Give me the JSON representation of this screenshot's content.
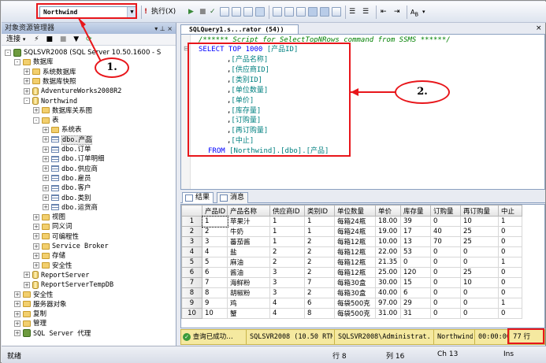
{
  "toolbar": {
    "database": "Northwind",
    "execute": "执行(X)",
    "execute_icon": "exclamation-icon"
  },
  "object_explorer": {
    "title": "对象资源管理器",
    "connect_label": "连接",
    "tree": [
      {
        "label": "SQLSVR2008 (SQL Server 10.50.1600 - S",
        "icon": "server",
        "exp": "-"
      },
      {
        "label": "数据库",
        "icon": "folder",
        "exp": "-"
      },
      {
        "label": "系统数据库",
        "icon": "folder",
        "exp": "+"
      },
      {
        "label": "数据库快照",
        "icon": "folder",
        "exp": "+"
      },
      {
        "label": "AdventureWorks2008R2",
        "icon": "db",
        "exp": "+"
      },
      {
        "label": "Northwind",
        "icon": "db",
        "exp": "-"
      },
      {
        "label": "数据库关系图",
        "icon": "folder",
        "exp": "+"
      },
      {
        "label": "表",
        "icon": "folder",
        "exp": "-"
      },
      {
        "label": "系统表",
        "icon": "folder",
        "exp": "+"
      },
      {
        "label": "dbo.产品",
        "icon": "table",
        "exp": "+"
      },
      {
        "label": "dbo.订单",
        "icon": "table",
        "exp": "+"
      },
      {
        "label": "dbo.订单明细",
        "icon": "table",
        "exp": "+"
      },
      {
        "label": "dbo.供应商",
        "icon": "table",
        "exp": "+"
      },
      {
        "label": "dbo.雇员",
        "icon": "table",
        "exp": "+"
      },
      {
        "label": "dbo.客户",
        "icon": "table",
        "exp": "+"
      },
      {
        "label": "dbo.类别",
        "icon": "table",
        "exp": "+"
      },
      {
        "label": "dbo.运货商",
        "icon": "table",
        "exp": "+"
      },
      {
        "label": "视图",
        "icon": "folder",
        "exp": "+"
      },
      {
        "label": "同义词",
        "icon": "folder",
        "exp": "+"
      },
      {
        "label": "可编程性",
        "icon": "folder",
        "exp": "+"
      },
      {
        "label": "Service Broker",
        "icon": "folder",
        "exp": "+"
      },
      {
        "label": "存储",
        "icon": "folder",
        "exp": "+"
      },
      {
        "label": "安全性",
        "icon": "folder",
        "exp": "+"
      },
      {
        "label": "ReportServer",
        "icon": "db",
        "exp": "+"
      },
      {
        "label": "ReportServerTempDB",
        "icon": "db",
        "exp": "+"
      },
      {
        "label": "安全性",
        "icon": "folder",
        "exp": "+"
      },
      {
        "label": "服务器对象",
        "icon": "folder",
        "exp": "+"
      },
      {
        "label": "复制",
        "icon": "folder",
        "exp": "+"
      },
      {
        "label": "管理",
        "icon": "folder",
        "exp": "+"
      },
      {
        "label": "SQL Server 代理",
        "icon": "agent",
        "exp": "+"
      }
    ]
  },
  "document_tab": "SQLQuery1.s...rator (54))",
  "editor": {
    "comment": "/****** Script for SelectTopNRows command from SSMS  ******/",
    "select": "SELECT TOP 1000",
    "columns": [
      "[产品ID]",
      "[产品名称]",
      "[供应商ID]",
      "[类别ID]",
      "[单位数量]",
      "[单价]",
      "[库存量]",
      "[订购量]",
      "[再订购量]",
      "[中止]"
    ],
    "from_kw": "FROM",
    "from_table": "[Northwind].[dbo].[产品]"
  },
  "results": {
    "tab_results": "结果",
    "tab_messages": "消息",
    "headers": [
      "产品ID",
      "产品名称",
      "供应商ID",
      "类别ID",
      "单位数量",
      "单价",
      "库存量",
      "订购量",
      "再订购量",
      "中止"
    ],
    "rows": [
      [
        "1",
        "1",
        "苹果汁",
        "1",
        "1",
        "每箱24瓶",
        "18.00",
        "39",
        "0",
        "10",
        "1"
      ],
      [
        "2",
        "2",
        "牛奶",
        "1",
        "1",
        "每箱24瓶",
        "19.00",
        "17",
        "40",
        "25",
        "0"
      ],
      [
        "3",
        "3",
        "蕃茄酱",
        "1",
        "2",
        "每箱12瓶",
        "10.00",
        "13",
        "70",
        "25",
        "0"
      ],
      [
        "4",
        "4",
        "盐",
        "2",
        "2",
        "每箱12瓶",
        "22.00",
        "53",
        "0",
        "0",
        "0"
      ],
      [
        "5",
        "5",
        "麻油",
        "2",
        "2",
        "每箱12瓶",
        "21.35",
        "0",
        "0",
        "0",
        "1"
      ],
      [
        "6",
        "6",
        "酱油",
        "3",
        "2",
        "每箱12瓶",
        "25.00",
        "120",
        "0",
        "25",
        "0"
      ],
      [
        "7",
        "7",
        "海鲜粉",
        "3",
        "7",
        "每箱30盒",
        "30.00",
        "15",
        "0",
        "10",
        "0"
      ],
      [
        "8",
        "8",
        "胡椒粉",
        "3",
        "2",
        "每箱30盒",
        "40.00",
        "6",
        "0",
        "0",
        "0"
      ],
      [
        "9",
        "9",
        "鸡",
        "4",
        "6",
        "每袋500克",
        "97.00",
        "29",
        "0",
        "0",
        "1"
      ],
      [
        "10",
        "10",
        "蟹",
        "4",
        "8",
        "每袋500克",
        "31.00",
        "31",
        "0",
        "0",
        "0"
      ]
    ]
  },
  "query_status": {
    "message": "查询已成功…",
    "server": "SQLSVR2008 (10.50 RTM)",
    "user": "SQLSVR2008\\Administrat...",
    "db": "Northwind",
    "time": "00:00:00",
    "rows": "77 行"
  },
  "statusbar": {
    "ready": "就绪",
    "line": "行 8",
    "col": "列 16",
    "ch": "Ch 13",
    "ins": "Ins"
  },
  "annotations": {
    "one": "1.",
    "two": "2."
  },
  "colors": {
    "callout": "#e8161b",
    "keyword": "#0000ff",
    "comment": "#008000",
    "identifier": "#008080"
  }
}
